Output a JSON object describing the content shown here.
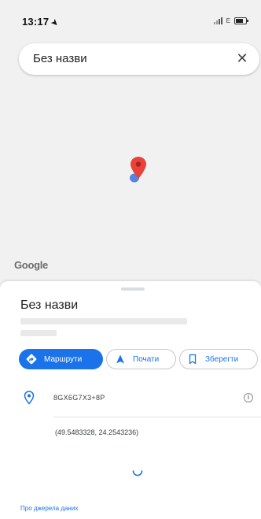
{
  "status_bar": {
    "time": "13:17",
    "network": "E"
  },
  "search": {
    "query": "Без назви",
    "clear_icon": "close-icon"
  },
  "map": {
    "logo_text": "Google",
    "pin_color": "#e8423a",
    "dot_color": "#4a7ee0"
  },
  "place": {
    "title": "Без назви",
    "plus_code": "8GX6G7X3+8P",
    "coordinates": "(49.5483328, 24.2543236)"
  },
  "actions": {
    "directions_label": "Маршрути",
    "start_label": "Почати",
    "save_label": "Зберегти"
  },
  "footer": {
    "about_link": "Про джерела даних"
  },
  "colors": {
    "accent": "#1a73e8",
    "background_map": "#f1f1f1"
  }
}
